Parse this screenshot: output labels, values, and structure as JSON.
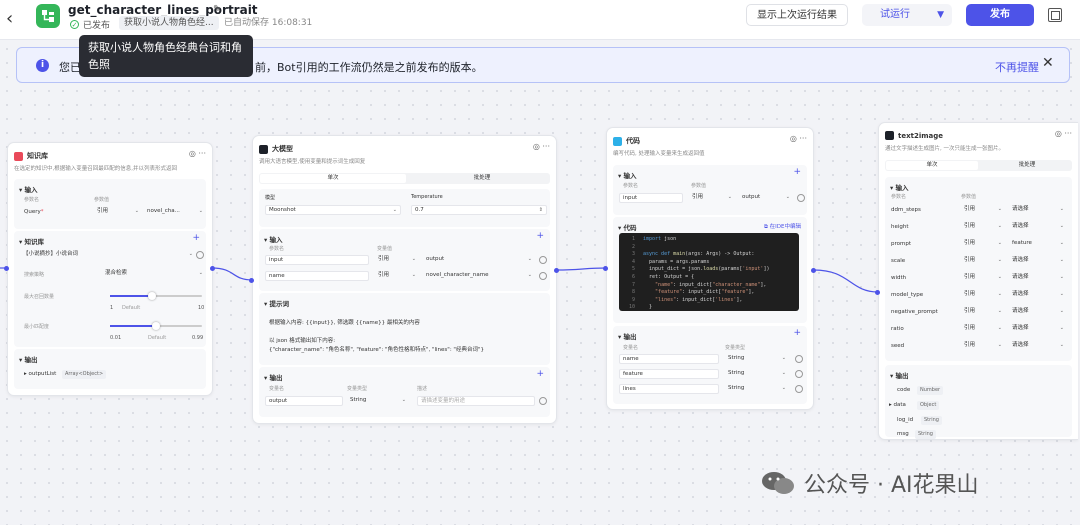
{
  "header": {
    "title": "get_character_lines_portrait",
    "status_label": "已发布",
    "desc_tag": "获取小说人物角色经...",
    "autosave": "已自动保存 16:08:31",
    "show_last_run": "显示上次运行结果",
    "test_run": "试运行",
    "publish": "发布"
  },
  "tooltip": "获取小说人物角色经典台词和角色照",
  "banner": {
    "text_left": "您已",
    "text_right": "前，Bot引用的工作流仍然是之前发布的版本。",
    "dismiss": "不再提醒"
  },
  "knowledge_node": {
    "title": "知识库",
    "desc": "在选定的知识中,根据输入变量召回最匹配的信息,并以列表形式返回",
    "input_title": "输入",
    "col_param": "参数名",
    "col_value": "参数值",
    "param": "Query",
    "ref": "引用",
    "ref_value": "novel_cha...",
    "kb_title": "知识库",
    "kb_item": "【小说摘抄】小说台词",
    "search_label": "搜索策略",
    "search_value": "混合检索",
    "max_label": "最大召回数量",
    "max_min": "1",
    "max_default": "Default",
    "max_max": "10",
    "min_label": "最小匹配度",
    "min_min": "0.01",
    "min_default": "Default",
    "min_max": "0.99",
    "output_title": "输出",
    "output_name": "outputList",
    "output_type": "Array<Object>"
  },
  "llm_node": {
    "title": "大模型",
    "desc": "调用大语言模型,使用变量和提示词生成回复",
    "tab_single": "单次",
    "tab_batch": "批处理",
    "model_label": "模型",
    "model_value": "Moonshot",
    "temp_label": "Temperature",
    "temp_value": "0.7",
    "input_title": "输入",
    "col_param": "参数名",
    "col_value": "变量值",
    "rows": [
      {
        "name": "input",
        "ref": "引用",
        "value": "output"
      },
      {
        "name": "name",
        "ref": "引用",
        "value": "novel_character_name"
      }
    ],
    "prompt_title": "提示词",
    "prompt_line1": "根据输入内容: {{input}}, 筛选跟 {{name}} 最相关的内容",
    "prompt_line2": "以 json 格式输出如下内容:",
    "prompt_line3": "{\"character_name\": \"角色名称\", \"feature\": \"角色性格和特点\", \"lines\": \"经典台词\"}",
    "output_title": "输出",
    "out_col_name": "变量名",
    "out_col_type": "变量类型",
    "out_col_desc": "描述",
    "out_name": "output",
    "out_type": "String",
    "out_desc_placeholder": "请描述变量的用途"
  },
  "code_node": {
    "title": "代码",
    "desc": "编写代码, 处理输入变量来生成返回值",
    "input_title": "输入",
    "col_param": "参数名",
    "col_value": "参数值",
    "in_name": "input",
    "in_ref": "引用",
    "in_value": "output",
    "code_title": "代码",
    "ide_link": "在IDE中编辑",
    "output_title": "输出",
    "out_col_name": "变量名",
    "out_col_type": "变量类型",
    "outputs": [
      {
        "name": "name",
        "type": "String"
      },
      {
        "name": "feature",
        "type": "String"
      },
      {
        "name": "lines",
        "type": "String"
      }
    ]
  },
  "image_node": {
    "title": "text2image",
    "desc": "通过文字描述生成图片, 一次只能生成一张图片。",
    "tab_single": "单次",
    "tab_batch": "批处理",
    "input_title": "输入",
    "col_param": "参数名",
    "col_value": "参数值",
    "rows": [
      {
        "name": "ddm_steps",
        "ref": "引用",
        "value": "请选择"
      },
      {
        "name": "height",
        "ref": "引用",
        "value": "请选择"
      },
      {
        "name": "prompt",
        "ref": "引用",
        "value": "feature"
      },
      {
        "name": "scale",
        "ref": "引用",
        "value": "请选择"
      },
      {
        "name": "width",
        "ref": "引用",
        "value": "请选择"
      },
      {
        "name": "model_type",
        "ref": "引用",
        "value": "请选择"
      },
      {
        "name": "negative_prompt",
        "ref": "引用",
        "value": "请选择"
      },
      {
        "name": "ratio",
        "ref": "引用",
        "value": "请选择"
      },
      {
        "name": "seed",
        "ref": "引用",
        "value": "请选择"
      }
    ],
    "output_title": "输出",
    "outputs": [
      {
        "name": "code",
        "type": "Number"
      },
      {
        "name": "data",
        "type": "Object"
      },
      {
        "name": "log_id",
        "type": "String"
      },
      {
        "name": "msg",
        "type": "String"
      }
    ]
  },
  "watermark": "公众号 · AI花果山",
  "colors": {
    "accent": "#4d53e8",
    "brand": "#34b659",
    "knowledge": "#e94a5a",
    "code_dark": "#1f1f1f"
  }
}
